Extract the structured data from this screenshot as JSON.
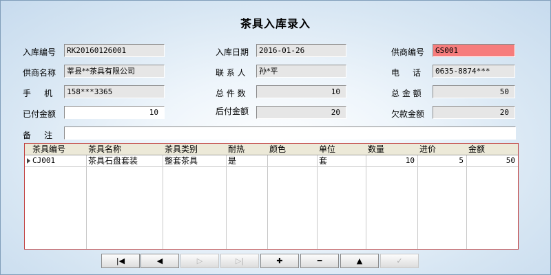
{
  "title": "茶具入库录入",
  "form": {
    "receipt_no_label": "入库编号",
    "receipt_no": "RK20160126001",
    "date_label": "入库日期",
    "date": "2016-01-26",
    "supplier_no_label": "供商编号",
    "supplier_no": "GS001",
    "supplier_name_label": "供商名称",
    "supplier_name": "莘县**茶具有限公司",
    "contact_label": "联 系 人",
    "contact": "孙*平",
    "phone_label": "电     话",
    "phone": "0635-8874***",
    "mobile_label": "手     机",
    "mobile": "158***3365",
    "total_qty_label": "总 件 数",
    "total_qty": "10",
    "total_amount_label": "总 金 额",
    "total_amount": "50",
    "paid_label": "已付金额",
    "paid": "10",
    "postpaid_label": "后付金额",
    "postpaid": "20",
    "owed_label": "欠款金额",
    "owed": "20",
    "remark_label": "备     注",
    "remark": ""
  },
  "table": {
    "columns": [
      "茶具编号",
      "茶具名称",
      "茶具类别",
      "耐热",
      "颜色",
      "单位",
      "数量",
      "进价",
      "金额"
    ],
    "rows": [
      [
        "CJ001",
        "茶具石盘套装",
        "整套茶具",
        "是",
        "",
        "套",
        "10",
        "5",
        "50"
      ]
    ]
  },
  "nav": {
    "first": "|◀",
    "prev": "◀",
    "next": "▷",
    "last": "▷|",
    "add": "✚",
    "delete": "━",
    "up": "▲",
    "post": "✓"
  }
}
